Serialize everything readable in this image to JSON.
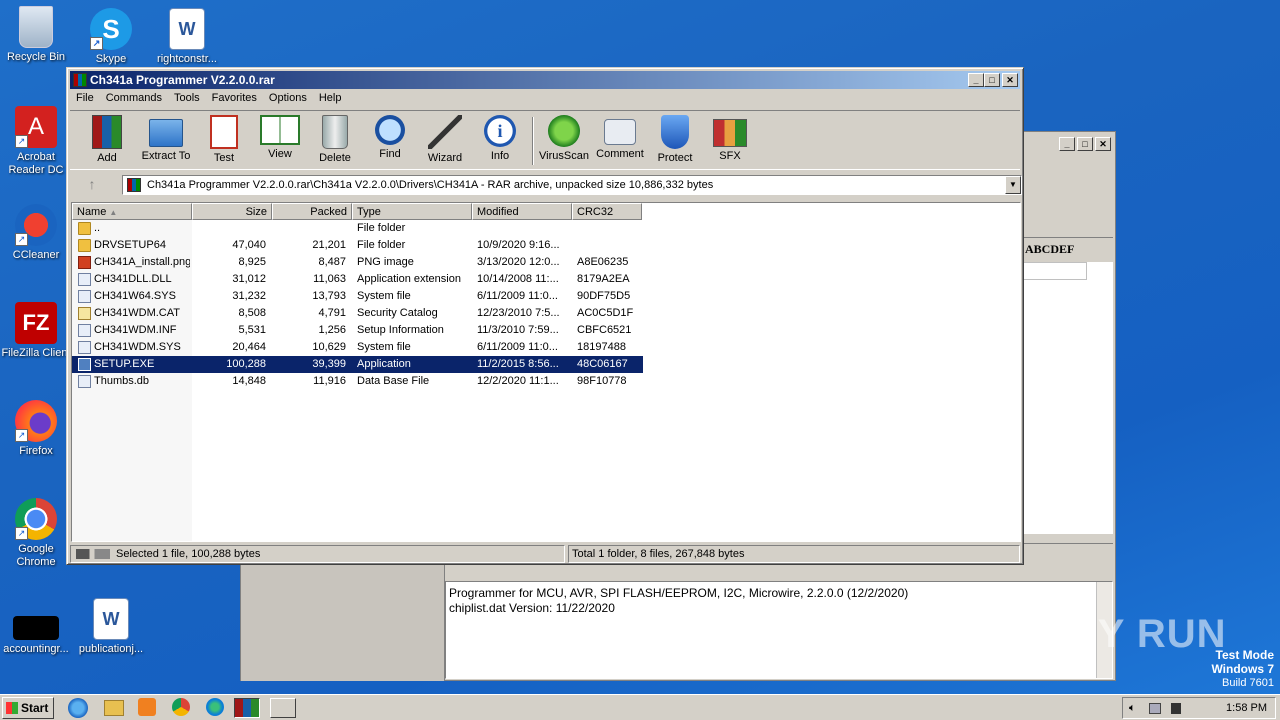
{
  "desktop": {
    "icons": [
      {
        "label": "Recycle Bin"
      },
      {
        "label": "Skype"
      },
      {
        "label": "rightconstr..."
      },
      {
        "label": "Acrobat Reader DC"
      },
      {
        "label": "CCleaner"
      },
      {
        "label": "FileZilla Client"
      },
      {
        "label": "Firefox"
      },
      {
        "label": "Google Chrome"
      },
      {
        "label": "accountingr..."
      },
      {
        "label": "publicationj..."
      }
    ]
  },
  "background_window": {
    "hex_header": "ABCDEF",
    "log_lines": [
      "Programmer for MCU, AVR, SPI FLASH/EEPROM, I2C, Microwire, 2.2.0.0 (12/2/2020)",
      "chiplist.dat Version: 11/22/2020"
    ]
  },
  "winrar": {
    "title": "Ch341a Programmer V2.2.0.0.rar",
    "menu": [
      "File",
      "Commands",
      "Tools",
      "Favorites",
      "Options",
      "Help"
    ],
    "toolbar": [
      "Add",
      "Extract To",
      "Test",
      "View",
      "Delete",
      "Find",
      "Wizard",
      "Info",
      "VirusScan",
      "Comment",
      "Protect",
      "SFX"
    ],
    "address": "Ch341a Programmer V2.2.0.0.rar\\Ch341a V2.2.0.0\\Drivers\\CH341A - RAR archive, unpacked size 10,886,332 bytes",
    "columns": [
      "Name",
      "Size",
      "Packed",
      "Type",
      "Modified",
      "CRC32"
    ],
    "files": [
      {
        "name": "..",
        "size": "",
        "packed": "",
        "type": "File folder",
        "modified": "",
        "crc": "",
        "icon": "folder"
      },
      {
        "name": "DRVSETUP64",
        "size": "47,040",
        "packed": "21,201",
        "type": "File folder",
        "modified": "10/9/2020 9:16...",
        "crc": "",
        "icon": "folder"
      },
      {
        "name": "CH341A_install.png",
        "size": "8,925",
        "packed": "8,487",
        "type": "PNG image",
        "modified": "3/13/2020 12:0...",
        "crc": "A8E06235",
        "icon": "png"
      },
      {
        "name": "CH341DLL.DLL",
        "size": "31,012",
        "packed": "11,063",
        "type": "Application extension",
        "modified": "10/14/2008 11:...",
        "crc": "8179A2EA",
        "icon": "sys"
      },
      {
        "name": "CH341W64.SYS",
        "size": "31,232",
        "packed": "13,793",
        "type": "System file",
        "modified": "6/11/2009 11:0...",
        "crc": "90DF75D5",
        "icon": "sys"
      },
      {
        "name": "CH341WDM.CAT",
        "size": "8,508",
        "packed": "4,791",
        "type": "Security Catalog",
        "modified": "12/23/2010 7:5...",
        "crc": "AC0C5D1F",
        "icon": "cat"
      },
      {
        "name": "CH341WDM.INF",
        "size": "5,531",
        "packed": "1,256",
        "type": "Setup Information",
        "modified": "11/3/2010 7:59...",
        "crc": "CBFC6521",
        "icon": "sys"
      },
      {
        "name": "CH341WDM.SYS",
        "size": "20,464",
        "packed": "10,629",
        "type": "System file",
        "modified": "6/11/2009 11:0...",
        "crc": "18197488",
        "icon": "sys"
      },
      {
        "name": "SETUP.EXE",
        "size": "100,288",
        "packed": "39,399",
        "type": "Application",
        "modified": "11/2/2015 8:56...",
        "crc": "48C06167",
        "icon": "exe",
        "selected": true
      },
      {
        "name": "Thumbs.db",
        "size": "14,848",
        "packed": "11,916",
        "type": "Data Base File",
        "modified": "12/2/2020 11:1...",
        "crc": "98F10778",
        "icon": "sys"
      }
    ],
    "status_left": "Selected 1 file, 100,288 bytes",
    "status_right": "Total 1 folder, 8 files, 267,848 bytes"
  },
  "taskbar": {
    "start": "Start",
    "clock": "1:58 PM"
  },
  "overlay": {
    "test_mode": "Test Mode",
    "os": "Windows 7",
    "build": "Build 7601",
    "watermark": "ANY RUN"
  }
}
